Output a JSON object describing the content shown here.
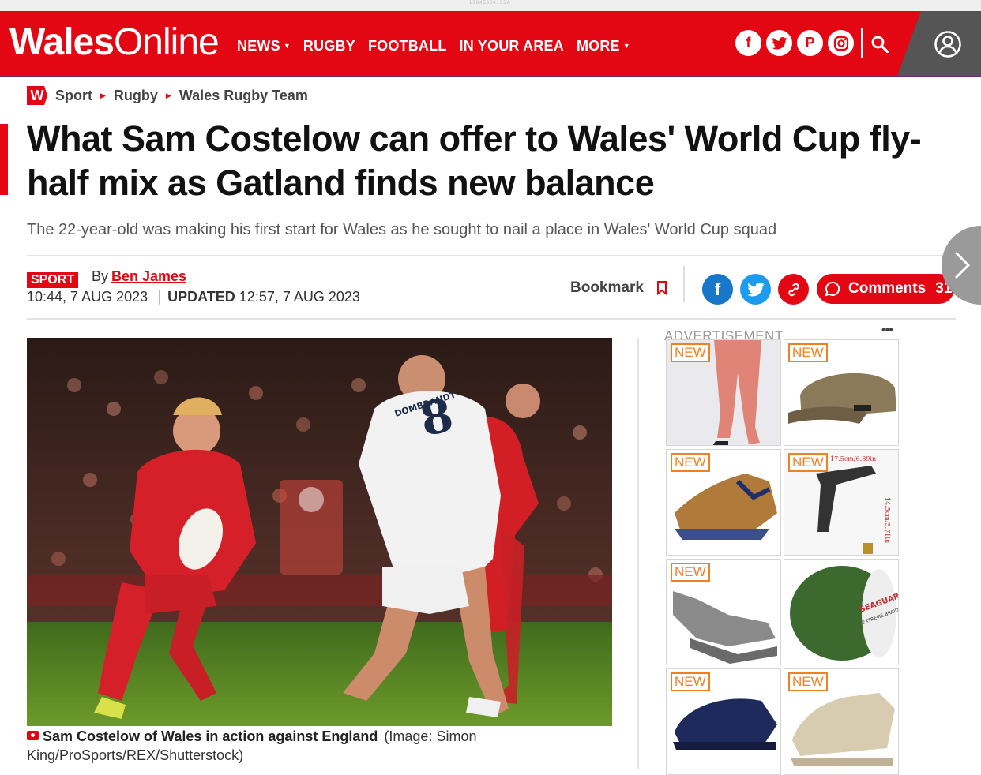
{
  "top_strip": {
    "text": "13845384133A"
  },
  "header": {
    "logo_bold": "Wales",
    "logo_light": "Online",
    "menu": [
      {
        "label": "NEWS",
        "dropdown": true
      },
      {
        "label": "RUGBY",
        "dropdown": false
      },
      {
        "label": "FOOTBALL",
        "dropdown": false
      },
      {
        "label": "IN YOUR AREA",
        "dropdown": false
      },
      {
        "label": "MORE",
        "dropdown": true
      }
    ],
    "social_icons": [
      "facebook-icon",
      "twitter-icon",
      "pinterest-icon",
      "instagram-icon"
    ],
    "brand_color": "#e30613"
  },
  "breadcrumb": {
    "badge": "W",
    "items": [
      "Sport",
      "Rugby",
      "Wales Rugby Team"
    ]
  },
  "article": {
    "headline": "What Sam Costelow can offer to Wales' World Cup fly-half mix as Gatland finds new balance",
    "standfirst": "The 22-year-old was making his first start for Wales as he sought to nail a place in Wales' World Cup squad",
    "section_tag": "SPORT",
    "by_prefix": "By",
    "author": "Ben James",
    "published": "10:44, 7 AUG 2023",
    "updated_label": "UPDATED",
    "updated": "12:57, 7 AUG 2023",
    "bookmark_label": "Bookmark",
    "comments_label": "Comments",
    "comments_count": "31",
    "photo": {
      "jersey_name": "DOMBRANDT",
      "jersey_number": "8"
    },
    "caption_bold": "Sam Costelow of Wales in action against England",
    "caption_credit": "(Image: Simon King/ProSports/REX/Shutterstock)"
  },
  "advert": {
    "label": "ADVERTISEMENT",
    "new_label": "NEW",
    "tiles": [
      "leggings",
      "cap",
      "trainers-brown",
      "hose-nozzle",
      "trainers-grey",
      "fishing-line",
      "clogs",
      "boots-beige"
    ],
    "brand_text": "SEAGUAR",
    "brand_sub": "EXTREME BRAID",
    "size_text_1": "17.5cm/6.89in",
    "size_text_2": "14.5cm/5.71in"
  }
}
